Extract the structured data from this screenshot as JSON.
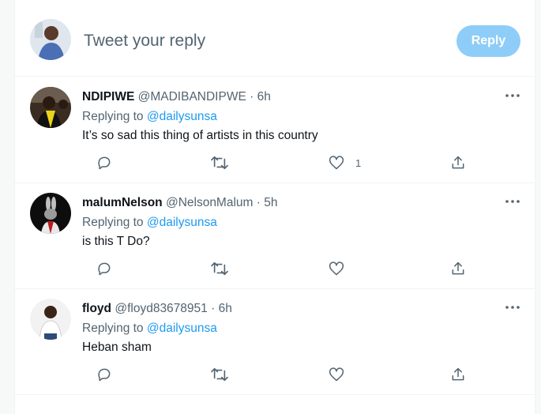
{
  "composer": {
    "placeholder": "Tweet your reply",
    "reply_label": "Reply"
  },
  "colors": {
    "accent": "#1d9bf0",
    "reply_button_disabled": "#8ecdf8",
    "secondary_text": "#536471",
    "primary_text": "#0f1419"
  },
  "replies": [
    {
      "display_name": "NDIPIWE",
      "handle": "@MADIBANDIPWE",
      "separator": "·",
      "time": "6h",
      "replying_label": "Replying to",
      "replying_to": "@dailysunsa",
      "text": "It’s so sad this thing of artists in this country",
      "like_count": "1"
    },
    {
      "display_name": "malumNelson",
      "handle": "@NelsonMalum",
      "separator": "·",
      "time": "5h",
      "replying_label": "Replying to",
      "replying_to": "@dailysunsa",
      "text": "is this T Do?",
      "like_count": ""
    },
    {
      "display_name": "floyd",
      "handle": "@floyd83678951",
      "separator": "·",
      "time": "6h",
      "replying_label": "Replying to",
      "replying_to": "@dailysunsa",
      "text": "Heban sham",
      "like_count": ""
    }
  ],
  "icons": [
    "more-icon",
    "reply-icon",
    "retweet-icon",
    "like-icon",
    "share-icon"
  ]
}
